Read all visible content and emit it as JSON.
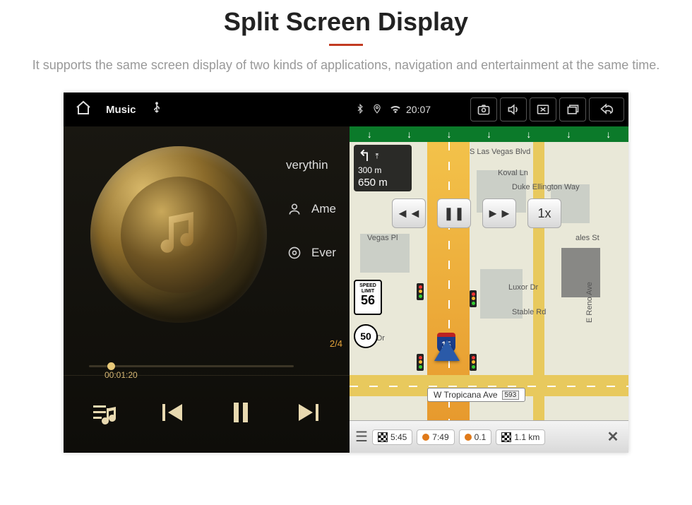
{
  "page": {
    "title": "Split Screen Display",
    "subtitle": "It supports the same screen display of two kinds of applications, navigation and entertainment at the same time."
  },
  "music": {
    "app_label": "Music",
    "song": "verythin",
    "artist": "Ame",
    "album": "Ever",
    "counter": "2/4",
    "elapsed": "00:01:20"
  },
  "status": {
    "clock": "20:07"
  },
  "nav": {
    "next_turn_distance": "300 m",
    "current_distance": "650 m",
    "speed_label": "SPEED LIMIT",
    "speed_value": "56",
    "route_num": "50",
    "highway": "15",
    "street_name": "W Tropicana Ave",
    "street_num": "593",
    "speed_multiplier": "1x",
    "roads": {
      "blvd": "S Las Vegas Blvd",
      "koval": "Koval Ln",
      "duke": "Duke Ellington Way",
      "ali": "ales St",
      "luxor": "Luxor Dr",
      "stable": "Stable Rd",
      "reno": "E Reno Ave",
      "vegas_pl": "Vegas Pl",
      "martin": "rtin Dr"
    }
  },
  "bottom": {
    "eta": "5:45",
    "clock_o": "7:49",
    "dist_o": "0.1",
    "remain": "1.1 km"
  }
}
